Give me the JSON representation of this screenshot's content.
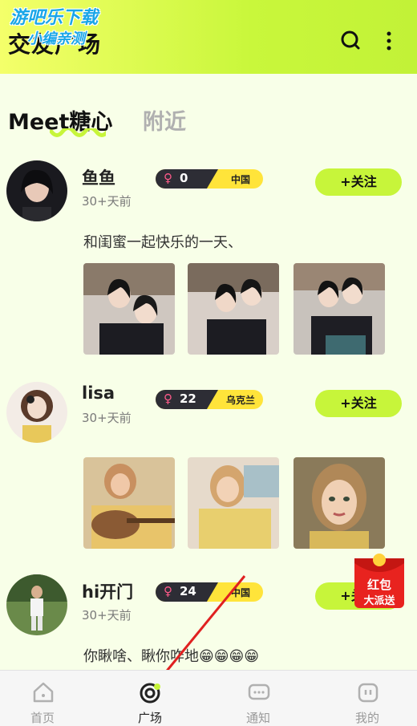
{
  "header": {
    "title": "交友广场",
    "watermark_line1": "游吧乐下载",
    "watermark_line2": "小编亲测"
  },
  "tabs": [
    {
      "label": "Meet糖心",
      "active": true
    },
    {
      "label": "附近",
      "active": false
    }
  ],
  "posts": [
    {
      "username": "鱼鱼",
      "time": "30+天前",
      "gender_symbol": "♀",
      "count": "0",
      "country": "中国",
      "follow_label": "+关注",
      "content": "和闺蜜一起快乐的一天、"
    },
    {
      "username": "lisa",
      "time": "30+天前",
      "gender_symbol": "♀",
      "count": "22",
      "country": "乌克兰",
      "follow_label": "+关注",
      "content": ""
    },
    {
      "username": "hi开门",
      "time": "30+天前",
      "gender_symbol": "♀",
      "count": "24",
      "country": "中国",
      "follow_label": "+关注",
      "content": "你瞅啥、瞅你咋地😁😁😁😁"
    }
  ],
  "redpacket": {
    "line1": "红包",
    "line2": "大派送"
  },
  "bottom_nav": [
    {
      "label": "首页",
      "icon": "home-icon",
      "active": false
    },
    {
      "label": "广场",
      "icon": "plaza-icon",
      "active": true
    },
    {
      "label": "通知",
      "icon": "message-icon",
      "active": false
    },
    {
      "label": "我的",
      "icon": "profile-icon",
      "active": false
    }
  ],
  "colors": {
    "accent": "#c7f53a",
    "badge_dark": "#2d2d35",
    "badge_yellow": "#ffe43a",
    "background": "#f8ffe8",
    "redpacket": "#e8231f"
  }
}
